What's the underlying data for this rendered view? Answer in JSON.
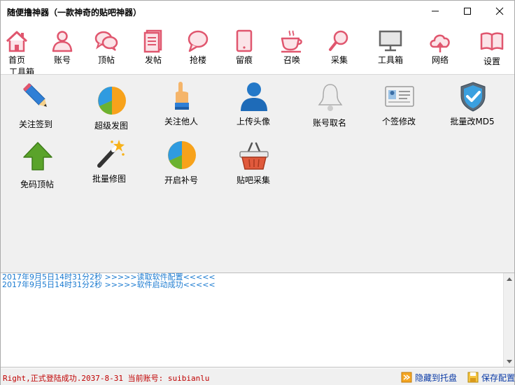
{
  "window": {
    "title": "随便撸神器（一款神奇的贴吧神器）"
  },
  "toolbar": {
    "items": [
      {
        "label": "首页",
        "icon": "home-icon"
      },
      {
        "label": "账号",
        "icon": "user-icon"
      },
      {
        "label": "顶帖",
        "icon": "chat-bubbles-icon"
      },
      {
        "label": "发帖",
        "icon": "document-icon"
      },
      {
        "label": "抢楼",
        "icon": "speech-bubble-icon"
      },
      {
        "label": "留痕",
        "icon": "tablet-icon"
      },
      {
        "label": "召唤",
        "icon": "cup-icon"
      },
      {
        "label": "采集",
        "icon": "search-icon"
      },
      {
        "label": "工具箱",
        "icon": "monitor-icon"
      },
      {
        "label": "网络",
        "icon": "cloud-icon"
      },
      {
        "label": "设置",
        "icon": "book-icon"
      }
    ],
    "accent": "#e0566e"
  },
  "tools_tab": "工具箱",
  "tools": [
    {
      "label": "关注签到",
      "icon": "pencil-icon"
    },
    {
      "label": "超级发图",
      "icon": "pie-chart-icon"
    },
    {
      "label": "关注他人",
      "icon": "pointing-hand-icon"
    },
    {
      "label": "上传头像",
      "icon": "user-avatar-icon"
    },
    {
      "label": "账号取名",
      "icon": "bell-icon"
    },
    {
      "label": "个签修改",
      "icon": "id-card-icon"
    },
    {
      "label": "批量改MD5",
      "icon": "shield-check-icon"
    },
    {
      "label": "免码顶帖",
      "icon": "up-arrow-icon"
    },
    {
      "label": "批量修图",
      "icon": "magic-wand-icon"
    },
    {
      "label": "开启补号",
      "icon": "pie-chart-icon"
    },
    {
      "label": "贴吧采集",
      "icon": "basket-icon"
    }
  ],
  "log": {
    "lines": [
      "2017年9月5日14时31分2秒 >>>>>读取软件配置<<<<<",
      "2017年9月5日14时31分2秒 >>>>>软件启动成功<<<<<"
    ],
    "color": "#1a7ad0"
  },
  "status": {
    "text": "Right,正式登陆成功.2037-8-31 当前账号: suibianlu",
    "hide_tray": "隐藏到托盘",
    "save_config": "保存配置",
    "text_color": "#c00000"
  }
}
